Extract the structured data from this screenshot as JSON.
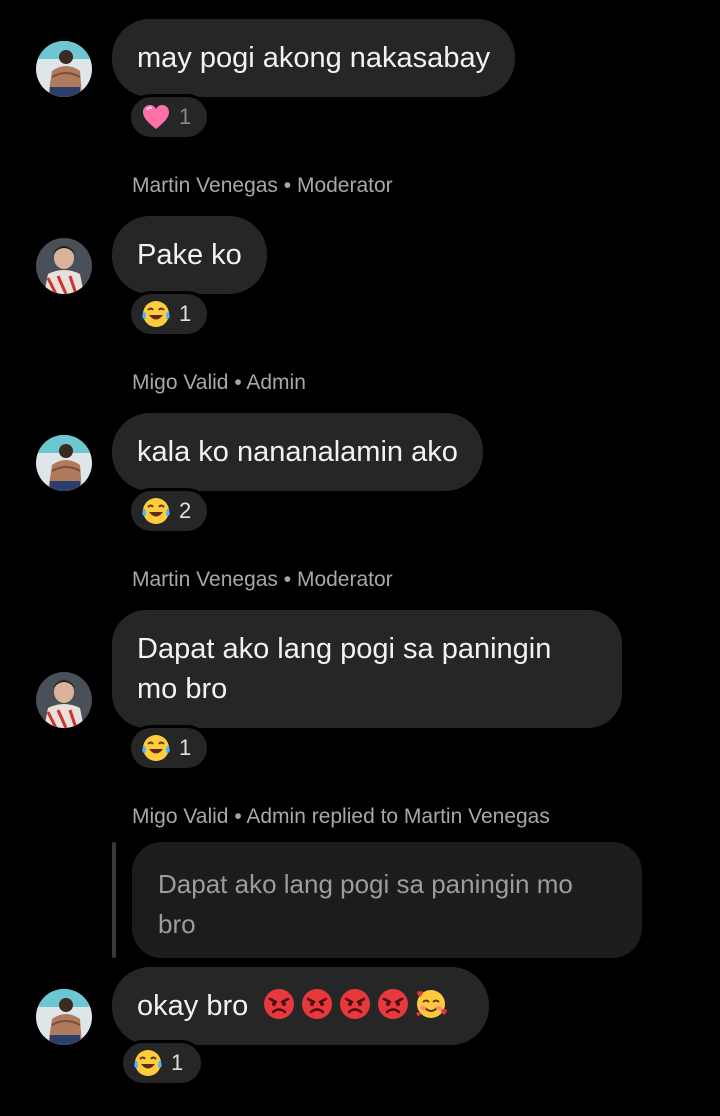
{
  "messages": [
    {
      "text": "may pogi akong nakasabay",
      "reaction": {
        "emoji": "pink-heart",
        "count": "1"
      }
    },
    {
      "sender": "Martin Venegas • Moderator",
      "text": "Pake ko",
      "reaction": {
        "emoji": "tears-of-joy",
        "count": "1"
      }
    },
    {
      "sender": "Migo Valid • Admin",
      "text": "kala ko nananalamin ako",
      "reaction": {
        "emoji": "tears-of-joy",
        "count": "2"
      }
    },
    {
      "sender": "Martin Venegas • Moderator",
      "text": "Dapat ako lang pogi sa paningin mo bro",
      "reaction": {
        "emoji": "tears-of-joy",
        "count": "1"
      }
    },
    {
      "sender": "Migo Valid • Admin replied to Martin Venegas",
      "quoted_text": "Dapat ako lang pogi sa paningin mo bro",
      "text": "okay bro",
      "inline_emojis": [
        "angry-face",
        "angry-face",
        "angry-face",
        "angry-face",
        "smiling-face-with-hearts"
      ],
      "reaction": {
        "emoji": "tears-of-joy",
        "count": "1"
      }
    }
  ],
  "colors": {
    "background": "#000000",
    "bubble": "#262626",
    "quote_bubble": "#1c1c1c",
    "sender_text": "#a8a8a8"
  }
}
